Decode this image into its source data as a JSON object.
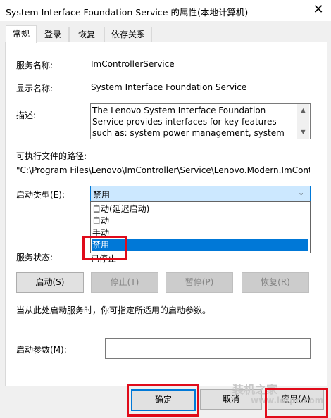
{
  "window": {
    "title": "System Interface Foundation Service 的属性(本地计算机)",
    "close_glyph": "✕"
  },
  "tabs": [
    {
      "label": "常规",
      "active": true
    },
    {
      "label": "登录",
      "active": false
    },
    {
      "label": "恢复",
      "active": false
    },
    {
      "label": "依存关系",
      "active": false
    }
  ],
  "general": {
    "service_name_label": "服务名称:",
    "service_name": "ImControllerService",
    "display_name_label": "显示名称:",
    "display_name": "System Interface Foundation Service",
    "description_label": "描述:",
    "description": "The Lenovo System Interface Foundation Service provides interfaces for key features such as: system power management, system optimization",
    "path_label": "可执行文件的路径:",
    "path": "\"C:\\Program Files\\Lenovo\\ImController\\Service\\Lenovo.Modern.ImController.exe\"",
    "startup_type_label": "启动类型(E):",
    "startup_type_value": "禁用",
    "startup_options": [
      "自动(延迟启动)",
      "自动",
      "手动",
      "禁用"
    ],
    "status_label": "服务状态:",
    "status_value": "已停止",
    "buttons": {
      "start": "启动(S)",
      "stop": "停止(T)",
      "pause": "暂停(P)",
      "resume": "恢复(R)"
    },
    "hint": "当从此处启动服务时，你可指定所适用的启动参数。",
    "params_label": "启动参数(M):",
    "params_value": ""
  },
  "footer": {
    "ok": "确定",
    "cancel": "取消",
    "apply": "应用(A)"
  },
  "watermark": {
    "brand": "装机之家",
    "site": "www.lotpc.com"
  },
  "colors": {
    "accent": "#0078d7",
    "highlight_box": "#e00b1a"
  }
}
